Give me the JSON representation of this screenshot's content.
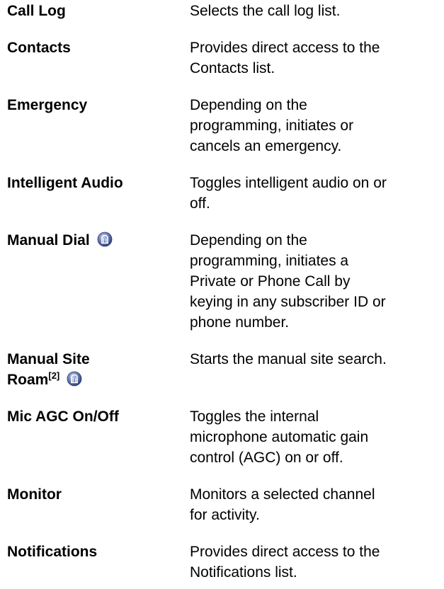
{
  "rows": [
    {
      "term": "Call Log",
      "desc_lines": [
        "Selects the call log list."
      ]
    },
    {
      "term": "Contacts",
      "desc_lines": [
        "Provides direct access to the",
        "Contacts list."
      ]
    },
    {
      "term": "Emergency",
      "desc_lines": [
        "Depending on the",
        "programming, initiates or",
        "cancels an emergency."
      ]
    },
    {
      "term": "Intelligent Audio",
      "desc_lines": [
        "Toggles intelligent audio on or",
        "off."
      ]
    },
    {
      "term": "Manual Dial",
      "desc_lines": [
        "Depending on the",
        "programming, initiates a",
        "Private or Phone Call by",
        "keying in any subscriber ID or",
        "phone number."
      ]
    },
    {
      "term_line1": "Manual Site",
      "term_line2": "Roam",
      "term_sup": "[2]",
      "desc_lines": [
        "Starts the manual site search."
      ]
    },
    {
      "term": "Mic AGC On/Off",
      "desc_lines": [
        "Toggles the internal",
        "microphone automatic gain",
        "control (AGC) on or off."
      ]
    },
    {
      "term": "Monitor",
      "desc_lines": [
        "Monitors a selected channel",
        "for activity."
      ]
    },
    {
      "term": "Notifications",
      "desc_lines": [
        "Provides direct access to the",
        "Notifications list."
      ]
    }
  ],
  "icons": {
    "feature_icon": "trunking-feature-icon"
  },
  "colors": {
    "icon_fill": "#6d7fb0",
    "icon_dark": "#2f3f7a"
  }
}
